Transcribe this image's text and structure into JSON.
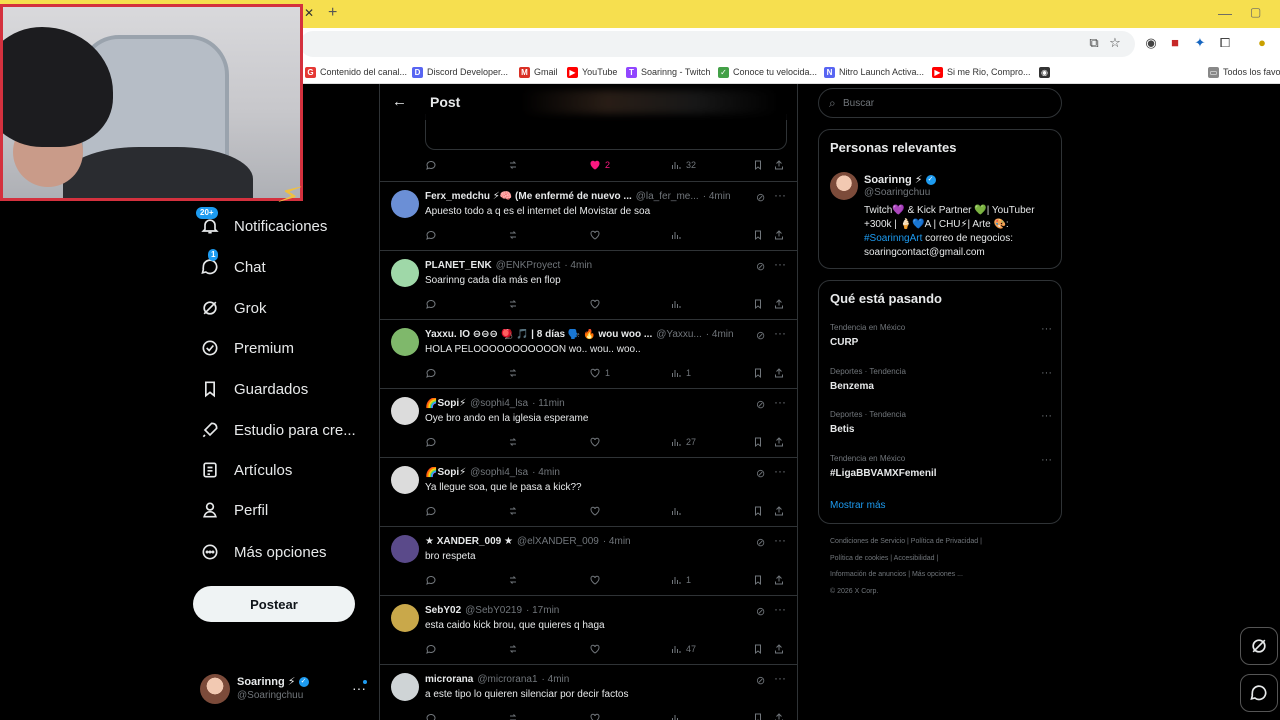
{
  "browser": {
    "bookmarks": [
      {
        "label": "Contenido del canal...",
        "color": "#e53935",
        "glyph": "G"
      },
      {
        "label": "Discord Developer...",
        "color": "#5865f2",
        "glyph": "D"
      },
      {
        "label": "Gmail",
        "color": "#d93025",
        "glyph": "M"
      },
      {
        "label": "YouTube",
        "color": "#ff0000",
        "glyph": "▶"
      },
      {
        "label": "Soarinng - Twitch",
        "color": "#9146ff",
        "glyph": "T"
      },
      {
        "label": "Conoce tu velocida...",
        "color": "#43a047",
        "glyph": "✓"
      },
      {
        "label": "Nitro Launch Activa...",
        "color": "#5865f2",
        "glyph": "N"
      },
      {
        "label": "Si me Rio, Compro...",
        "color": "#ff0000",
        "glyph": "▶"
      },
      {
        "label": "",
        "color": "#333333",
        "glyph": "◉"
      },
      {
        "label": "Todos los favor",
        "color": "#888888",
        "glyph": "▭"
      }
    ]
  },
  "nav": {
    "notifications": {
      "label": "Notificaciones",
      "badge": "20+",
      "icon": "bell-icon"
    },
    "chat": {
      "label": "Chat",
      "badge": "1",
      "icon": "chat-icon"
    },
    "grok": {
      "label": "Grok",
      "icon": "grok-icon"
    },
    "premium": {
      "label": "Premium",
      "icon": "premium-icon"
    },
    "bookmarks": {
      "label": "Guardados",
      "icon": "bookmark-icon"
    },
    "studio": {
      "label": "Estudio para cre...",
      "icon": "rocket-icon"
    },
    "articles": {
      "label": "Artículos",
      "icon": "article-icon"
    },
    "profile": {
      "label": "Perfil",
      "icon": "person-icon"
    },
    "more": {
      "label": "Más opciones",
      "icon": "more-circle-icon"
    },
    "post_button": "Postear",
    "account": {
      "name": "Soarinng ⚡",
      "handle": "@Soaringchuu"
    }
  },
  "main": {
    "header_title": "Post",
    "original_actions": {
      "likes": "2",
      "views": "32"
    },
    "replies": [
      {
        "name": "Ferx_medchu ⚡🧠 (Me enfermé de nuevo ...",
        "handle": "@la_fer_me...",
        "time": "· 4min",
        "text": "Apuesto todo a q es el internet del Movistar de soa",
        "likes": "",
        "views": "",
        "avatar": "#6b8fd6"
      },
      {
        "name": "PLANET_ENK",
        "handle": "@ENKProyect",
        "time": "· 4min",
        "text": "Soarinng cada día más en flop",
        "likes": "",
        "views": "",
        "avatar": "#9fd8a8"
      },
      {
        "name": "Yaxxu. IO ⊖⊖⊖ 🪀 🎵 | 8 días 🗣️ 🔥 wou woo ...",
        "handle": "@Yaxxu...",
        "time": "· 4min",
        "text": "HOLA PELOOOOOOOOOOON wo.. wou.. woo..",
        "likes": "1",
        "views": "1",
        "avatar": "#7fb86b"
      },
      {
        "name": "🌈Sopi⚡",
        "handle": "@sophi4_lsa",
        "time": "· 11min",
        "text": "Oye bro ando en la iglesia esperame",
        "likes": "",
        "views": "27",
        "avatar": "#dcdcdc"
      },
      {
        "name": "🌈Sopi⚡",
        "handle": "@sophi4_lsa",
        "time": "· 4min",
        "text": "Ya llegue soa, que le pasa a kick??",
        "likes": "",
        "views": "",
        "avatar": "#dcdcdc"
      },
      {
        "name": "★ XANDER_009 ★",
        "handle": "@elXANDER_009",
        "time": "· 4min",
        "text": "bro respeta",
        "likes": "",
        "views": "1",
        "avatar": "#5a4a8a"
      },
      {
        "name": "SebY02",
        "handle": "@SebY0219",
        "time": "· 17min",
        "text": "esta caido kick brou, que quieres q haga",
        "likes": "",
        "views": "47",
        "avatar": "#c9a84a"
      },
      {
        "name": "microrana",
        "handle": "@microrana1",
        "time": "· 4min",
        "text": "a este tipo lo quieren silenciar por decir factos",
        "likes": "",
        "views": "",
        "avatar": "#cfd4d6"
      }
    ]
  },
  "right": {
    "search_placeholder": "Buscar",
    "relevant_title": "Personas relevantes",
    "relevant_name": "Soarinng ⚡",
    "relevant_handle": "@Soaringchuu",
    "relevant_bio_1": "Twitch💜 & Kick Partner 💚| YouTuber +300k | 🍦💙A | CHU⚡| Arte 🎨:",
    "relevant_bio_tag": "#SoarinngArt",
    "relevant_bio_2": " correo de negocios: soaringcontact@gmail.com",
    "trends_title": "Qué está pasando",
    "trends": [
      {
        "context": "Tendencia en México",
        "name": "CURP"
      },
      {
        "context": "Deportes · Tendencia",
        "name": "Benzema"
      },
      {
        "context": "Deportes · Tendencia",
        "name": "Betis"
      },
      {
        "context": "Tendencia en México",
        "name": "#LigaBBVAMXFemenil"
      }
    ],
    "show_more": "Mostrar más",
    "footer": [
      "Condiciones de Servicio  |  Política de Privacidad  |",
      "Política de cookies  |  Accesibilidad  |",
      "Información de anuncios  |  Más opciones ...",
      "© 2026 X Corp."
    ]
  }
}
